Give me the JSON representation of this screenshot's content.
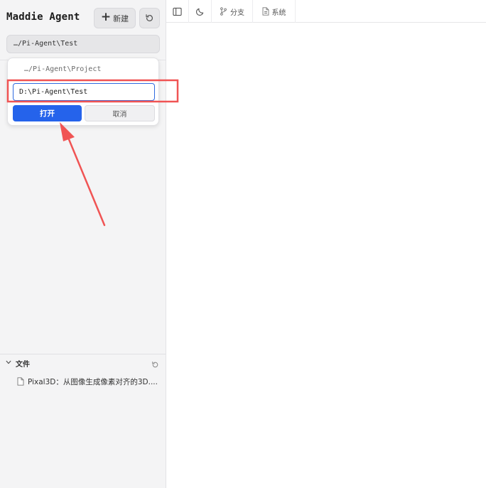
{
  "sidebar": {
    "app_title": "Maddie Agent",
    "new_button_label": "新建",
    "current_path": "…/Pi-Agent\\Test",
    "popover": {
      "recent_item": "…/Pi-Agent\\Project",
      "input_value": "D:\\Pi-Agent\\Test",
      "open_label": "打开",
      "cancel_label": "取消"
    },
    "files": {
      "header": "文件",
      "items": [
        {
          "name": "Pixal3D：从图像生成像素对齐的3D...."
        }
      ]
    }
  },
  "toolbar": {
    "branch_label": "分支",
    "system_label": "系统"
  },
  "colors": {
    "accent": "#2563eb",
    "annotation": "#f05454",
    "sidebar_bg": "#f4f4f5"
  },
  "icons": {
    "refresh": "refresh-icon",
    "sidebar_toggle": "sidebar-toggle-icon",
    "theme": "moon-icon",
    "branch": "git-branch-icon",
    "system": "document-icon",
    "file": "file-icon"
  }
}
